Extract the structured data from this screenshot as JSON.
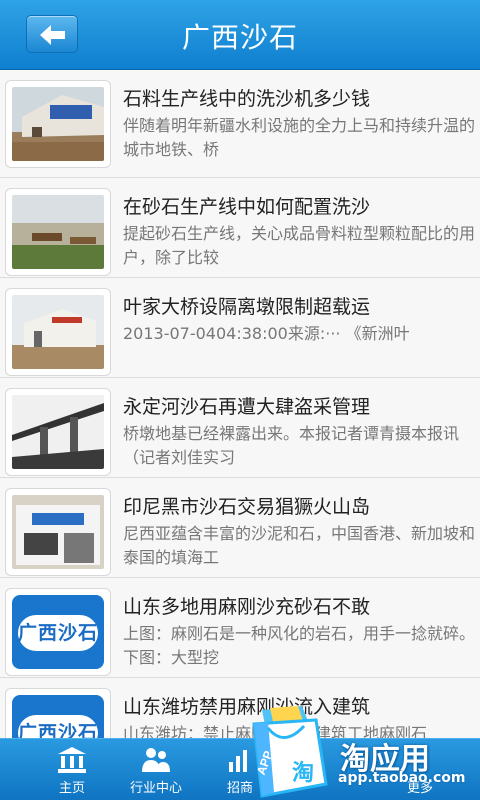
{
  "header": {
    "title": "广西沙石",
    "back_icon": "back-arrow-icon"
  },
  "articles": [
    {
      "title": "石料生产线中的洗沙机多少钱",
      "desc": "伴随着明年新疆水利设施的全力上马和持续升温的城市地铁、桥"
    },
    {
      "title": "在砂石生产线中如何配置洗沙",
      "desc": "提起砂石生产线，关心成品骨料粒型颗粒配比的用户，除了比较"
    },
    {
      "title": "叶家大桥设隔离墩限制超载运",
      "desc": "2013-07-0404:38:00来源:··· 《新洲叶"
    },
    {
      "title": "永定河沙石再遭大肆盗采管理",
      "desc": "桥墩地基已经裸露出来。本报记者谭青摄本报讯（记者刘佳实习"
    },
    {
      "title": "印尼黑市沙石交易猖獗火山岛",
      "desc": "尼西亚蕴含丰富的沙泥和石，中国香港、新加坡和泰国的填海工"
    },
    {
      "title": "山东多地用麻刚沙充砂石不敢",
      "desc": "上图：麻刚石是一种风化的岩石，用手一捻就碎。下图：大型挖"
    },
    {
      "title": "山东潍坊禁用麻刚沙流入建筑",
      "desc": "山东潍坊：禁止麻刚沙流入建筑工地麻刚石"
    }
  ],
  "thumb_logo_text": "广西沙石",
  "tabs": [
    {
      "label": "主页",
      "icon": "bank-icon"
    },
    {
      "label": "行业中心",
      "icon": "users-icon"
    },
    {
      "label": "招商",
      "icon": "signal-icon"
    },
    {
      "label": "",
      "icon": ""
    },
    {
      "label": "更多",
      "icon": "more-icon"
    }
  ],
  "promo": {
    "brand": "淘应用",
    "url": "app.taobao.com",
    "bag_text": "APP",
    "bag_char": "淘"
  },
  "colors": {
    "header": "#1a8fdb",
    "tabbar": "#1680cc",
    "accent": "#1976cc"
  }
}
